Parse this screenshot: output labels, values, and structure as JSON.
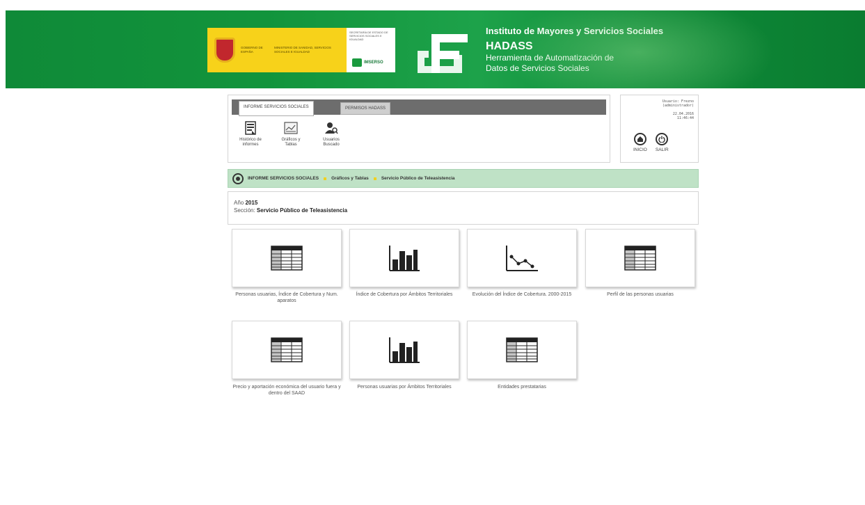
{
  "header": {
    "gobierno_text": "GOBIERNO DE ESPAÑA",
    "ministerio_text": "MINISTERIO DE SANIDAD, SERVICIOS SOCIALES E IGUALDAD",
    "secretaria_text": "SECRETARÍA DE ESTADO DE SERVICIOS SOCIALES E IGUALDAD",
    "imserso_label": "IMSERSO",
    "institute": "Instituto de Mayores y Servicios Sociales",
    "app_name": "HADASS",
    "app_desc_line1": "Herramienta de Automatización de",
    "app_desc_line2": "Datos de Servicios Sociales"
  },
  "tabs": [
    {
      "label": "INFORME SERVICIOS SOCIALES",
      "active": true
    },
    {
      "label": "PERMISOS HADASS",
      "active": false
    }
  ],
  "menu": [
    {
      "icon": "document-history-icon",
      "label_line1": "Histórico de",
      "label_line2": "informes"
    },
    {
      "icon": "chart-table-icon",
      "label_line1": "Gráficos y",
      "label_line2": "Tablas"
    },
    {
      "icon": "user-search-icon",
      "label_line1": "Usuarios",
      "label_line2": "Buscado"
    }
  ],
  "user": {
    "line1": "Usuario: Frezno",
    "line2": "(administrador)",
    "date": "22.04.2016",
    "time": "11:46:44",
    "home_label": "INICIO",
    "logout_label": "SALIR"
  },
  "breadcrumb": [
    "INFORME SERVICIOS SOCIALES",
    "Gráficos y Tablas",
    "Servicio Público de Teleasistencia"
  ],
  "info": {
    "year_label": "Año",
    "year_value": "2015",
    "section_label": "Sección",
    "section_value": "Servicio Público de Teleasistencia"
  },
  "reports": [
    {
      "icon": "table-icon",
      "label": "Personas usuarias, Índice de Cobertura y Num. aparatos"
    },
    {
      "icon": "bar-chart-icon",
      "label": "Índice de Cobertura por Ámbitos Territoriales"
    },
    {
      "icon": "line-chart-icon",
      "label": "Evolución del Índice de Cobertura. 2000-2015"
    },
    {
      "icon": "table-icon",
      "label": "Perfil de las personas usuarias"
    },
    {
      "icon": "table-icon",
      "label": "Precio y aportación económica del usuario fuera y dentro del SAAD"
    },
    {
      "icon": "bar-chart-icon",
      "label": "Personas usuarias por Ámbitos Territoriales"
    },
    {
      "icon": "table-icon",
      "label": "Entidades prestatarias"
    }
  ],
  "colors": {
    "header_green": "#12943c",
    "breadcrumb_bg": "#bfe2c6",
    "accent_yellow": "#f0d020"
  }
}
